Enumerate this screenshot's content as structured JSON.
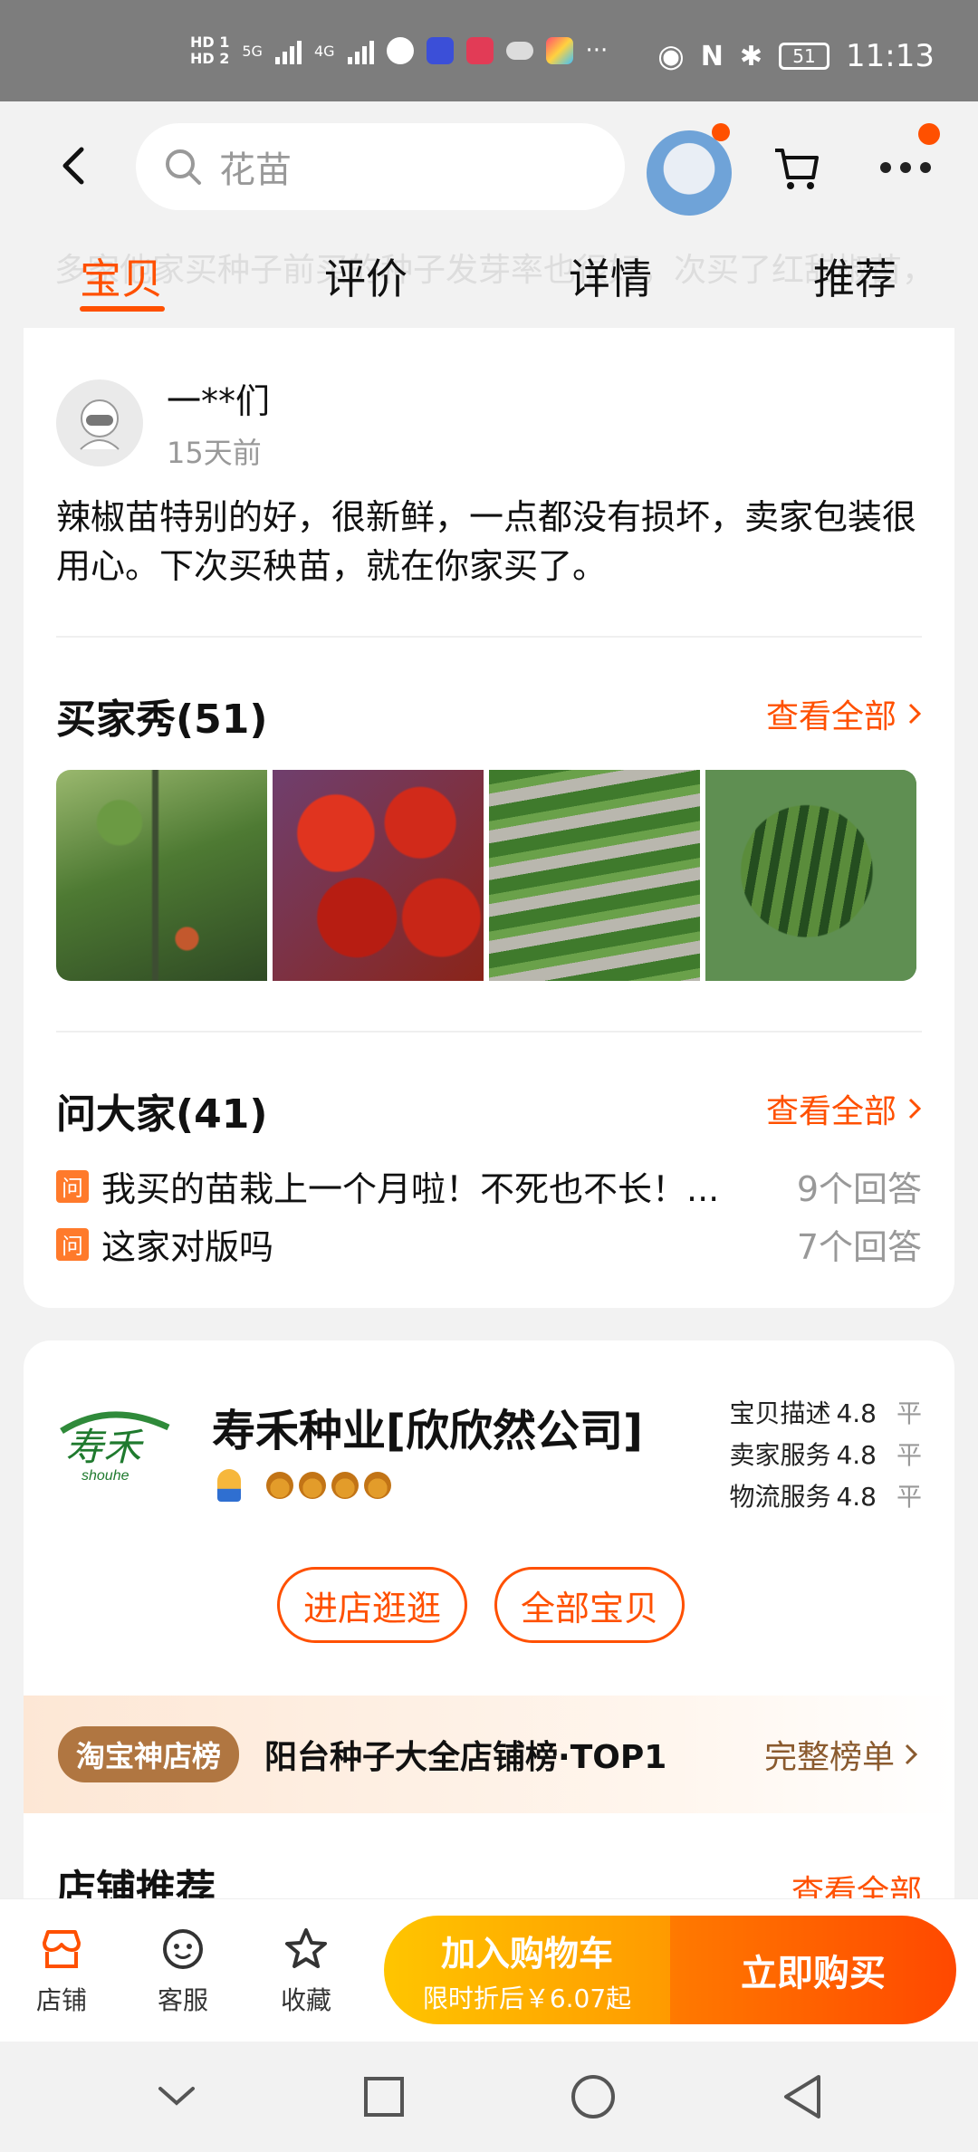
{
  "status_bar": {
    "hd1": "HD 1",
    "hd2": "HD 2",
    "net1": "5G",
    "net2": "4G",
    "battery": "51",
    "time": "11:13"
  },
  "search": {
    "placeholder": "花苗"
  },
  "tabs": [
    {
      "label": "宝贝",
      "active": true
    },
    {
      "label": "评价",
      "active": false
    },
    {
      "label": "详情",
      "active": false
    },
    {
      "label": "推荐",
      "active": false
    }
  ],
  "ghost_text": "多家他家买种子前买的种子发芽率也很好，次买了红甜椒苗，专用包装好，小苗很新鲜，根系…",
  "review": {
    "user": "一**们",
    "time": "15天前",
    "text": "辣椒苗特别的好，很新鲜，一点都没有损坏，卖家包装很用心。下次买秧苗，就在你家买了。"
  },
  "buyer_show": {
    "title": "买家秀(51)",
    "see_all": "查看全部"
  },
  "ask": {
    "title": "问大家(41)",
    "see_all": "查看全部",
    "items": [
      {
        "badge": "问",
        "question": "我买的苗栽上一个月啦！不死也不长！...",
        "answers": "9个回答"
      },
      {
        "badge": "问",
        "question": "这家对版吗",
        "answers": "7个回答"
      }
    ]
  },
  "shop": {
    "logo_text": "寿禾",
    "logo_sub": "shouhe",
    "name": "寿禾种业[欣欣然公司]",
    "scores": [
      {
        "label": "宝贝描述",
        "value": "4.8",
        "tag": "平"
      },
      {
        "label": "卖家服务",
        "value": "4.8",
        "tag": "平"
      },
      {
        "label": "物流服务",
        "value": "4.8",
        "tag": "平"
      }
    ],
    "crowns": 4,
    "btn_visit": "进店逛逛",
    "btn_all": "全部宝贝",
    "rank_pill": "淘宝神店榜",
    "rank_title": "阳台种子大全店铺榜·TOP1",
    "rank_link": "完整榜单",
    "rec_title": "店铺推荐",
    "rec_more": "查看全部"
  },
  "bottom": {
    "store": "店铺",
    "service": "客服",
    "favorite": "收藏",
    "add_cart": "加入购物车",
    "add_cart_sub": "限时折后￥6.07起",
    "buy_now": "立即购买"
  },
  "colors": {
    "accent": "#ff5000",
    "yellow": "#ffc500"
  }
}
